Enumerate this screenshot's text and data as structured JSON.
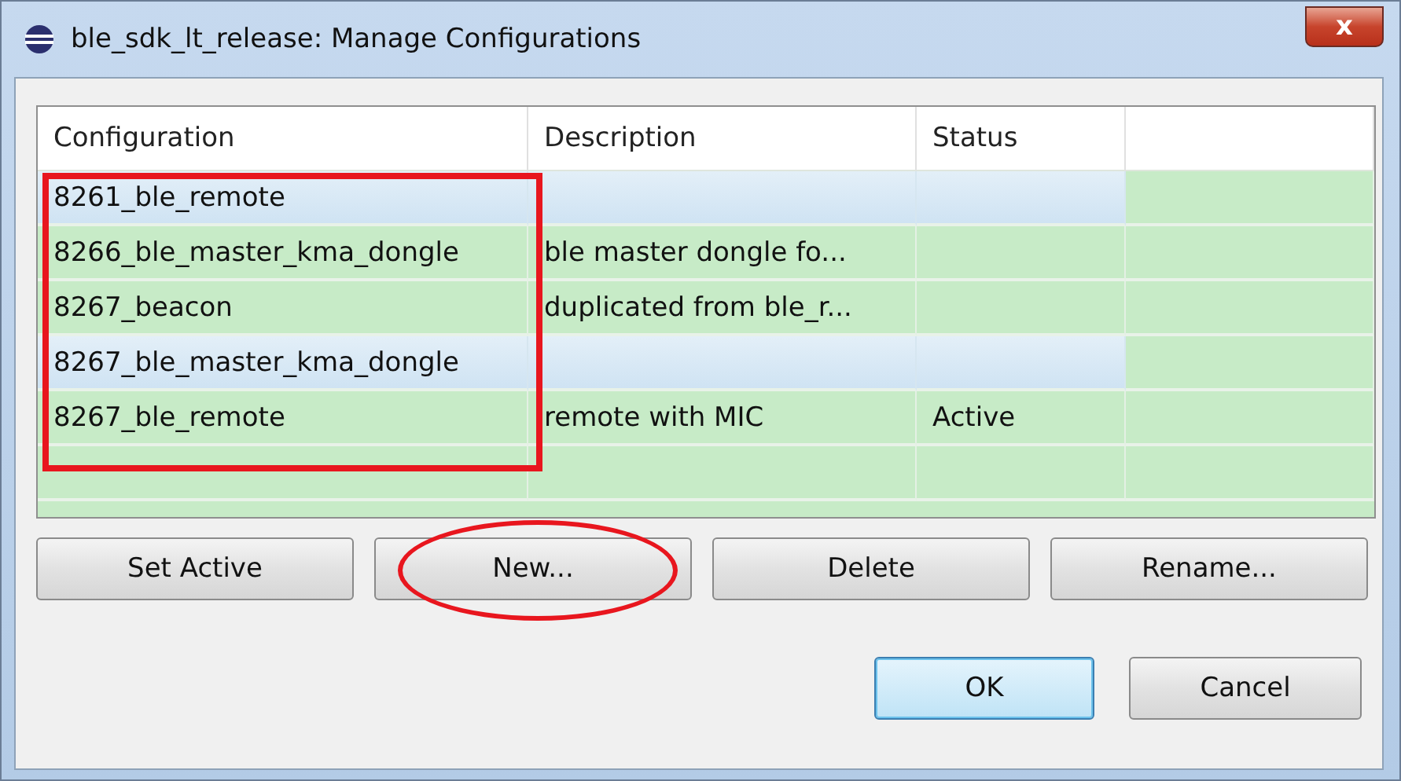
{
  "window": {
    "title": "ble_sdk_lt_release: Manage Configurations",
    "close": "x"
  },
  "table": {
    "columns": [
      {
        "label": "Configuration"
      },
      {
        "label": "Description"
      },
      {
        "label": "Status"
      }
    ],
    "rows": [
      {
        "cells": [
          "8261_ble_remote",
          "",
          ""
        ],
        "selected": true
      },
      {
        "cells": [
          "8266_ble_master_kma_dongle",
          "ble master dongle fo...",
          ""
        ],
        "selected": false
      },
      {
        "cells": [
          "8267_beacon",
          "duplicated from ble_r...",
          ""
        ],
        "selected": false
      },
      {
        "cells": [
          "8267_ble_master_kma_dongle",
          "",
          ""
        ],
        "selected": true
      },
      {
        "cells": [
          "8267_ble_remote",
          "remote with MIC",
          "Active"
        ],
        "selected": false
      },
      {
        "cells": [
          "",
          "",
          ""
        ],
        "selected": false
      }
    ]
  },
  "actions": [
    "Set Active",
    "New...",
    "Delete",
    "Rename..."
  ],
  "buttons": [
    {
      "label": "OK",
      "default": true
    },
    {
      "label": "Cancel",
      "default": false
    }
  ],
  "annotations": [
    {
      "kind": "rectangle"
    },
    {
      "kind": "ellipse"
    }
  ]
}
